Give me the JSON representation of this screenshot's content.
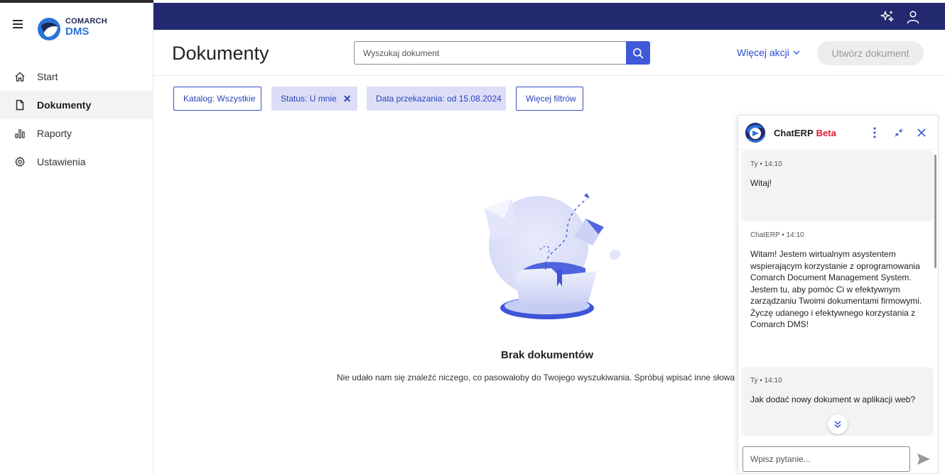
{
  "app": {
    "brand_line1": "COMARCH",
    "brand_line2": "DMS"
  },
  "sidebar": {
    "items": [
      {
        "label": "Start",
        "icon": "home-icon",
        "active": false
      },
      {
        "label": "Dokumenty",
        "icon": "document-icon",
        "active": true
      },
      {
        "label": "Raporty",
        "icon": "bar-chart-icon",
        "active": false
      },
      {
        "label": "Ustawienia",
        "icon": "gear-icon",
        "active": false
      }
    ]
  },
  "topbar": {
    "icons": [
      "ai-sparkle-icon",
      "user-icon"
    ],
    "color": "#23296f"
  },
  "header": {
    "title": "Dokumenty",
    "search_placeholder": "Wyszukaj dokument",
    "more_actions": "Więcej akcji",
    "create_button": "Utwórz dokument"
  },
  "filters": {
    "catalog": "Katalog: Wszystkie",
    "status": "Status: U mnie",
    "date": "Data przekazania: od 15.08.2024",
    "more": "Więcej filtrów"
  },
  "empty": {
    "title": "Brak dokumentów",
    "description": "Nie udało nam się znaleźć niczego, co pasowałoby do Twojego wyszukiwania. Spróbuj wpisać inne słowa kluc"
  },
  "chat": {
    "title": "ChatERP",
    "badge": "Beta",
    "messages": [
      {
        "author": "Ty",
        "time": "14:10",
        "text": "Witaj!"
      },
      {
        "author": "ChatERP",
        "time": "14:10",
        "text": "Witam! Jestem wirtualnym asystentem wspierającym korzystanie z oprogramowania Comarch Document Management System. Jestem tu, aby pomóc Ci w efektywnym zarządzaniu Twoimi dokumentami firmowymi. Życzę udanego i efektywnego korzystania z Comarch DMS!"
      },
      {
        "author": "Ty",
        "time": "14:10",
        "text": "Jak dodać nowy dokument w aplikacji web?"
      }
    ],
    "input_placeholder": "Wpisz pytanie..."
  },
  "colors": {
    "accent": "#3f5ad8",
    "link": "#2c4bd1",
    "beta": "#e3192f",
    "chip_fill": "#dcdef8"
  }
}
